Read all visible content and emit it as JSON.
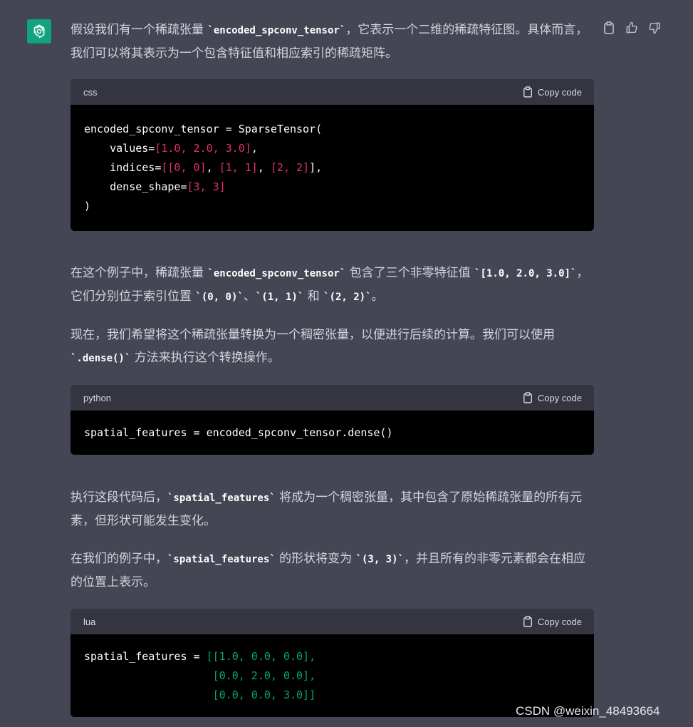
{
  "assistant": {
    "avatar_icon": "openai-logo-icon",
    "avatar_color": "#10a37f"
  },
  "actions": {
    "icons": [
      "clipboard-icon",
      "thumbs-up-icon",
      "thumbs-down-icon"
    ]
  },
  "message": {
    "p1": {
      "t1": "假设我们有一个稀疏张量 ",
      "c1": "`encoded_spconv_tensor`",
      "t2": "，它表示一个二维的稀疏特征图。具体而言，我们可以将其表示为一个包含特征值和相应索引的稀疏矩阵。"
    },
    "code1": {
      "lang": "css",
      "copy_label": "Copy code",
      "l1": "encoded_spconv_tensor = SparseTensor(",
      "l2a": "    values=",
      "l2n": "[1.0, 2.0, 3.0]",
      "l2b": ",",
      "l3a": "    indices=",
      "l3n1": "[[0, 0]",
      "l3s1": ", ",
      "l3n2": "[1, 1]",
      "l3s2": ", ",
      "l3n3": "[2, 2]",
      "l3b": "],",
      "l4a": "    dense_shape=",
      "l4n": "[3, 3]",
      "l5": ")"
    },
    "p2": {
      "t1": "在这个例子中，稀疏张量 ",
      "c1": "`encoded_spconv_tensor`",
      "t2": " 包含了三个非零特征值 ",
      "c2": "`[1.0, 2.0, 3.0]`",
      "t3": "，它们分别位于索引位置 ",
      "c3": "`(0, 0)`",
      "t4": "、",
      "c4": "`(1, 1)`",
      "t5": " 和 ",
      "c5": "`(2, 2)`",
      "t6": "。"
    },
    "p3": {
      "t1": "现在，我们希望将这个稀疏张量转换为一个稠密张量，以便进行后续的计算。我们可以使用 ",
      "c1": "`.dense()`",
      "t2": " 方法来执行这个转换操作。"
    },
    "code2": {
      "lang": "python",
      "copy_label": "Copy code",
      "l1": "spatial_features = encoded_spconv_tensor.dense()"
    },
    "p4": {
      "t1": "执行这段代码后，",
      "c1": "`spatial_features`",
      "t2": " 将成为一个稠密张量，其中包含了原始稀疏张量的所有元素，但形状可能发生变化。"
    },
    "p5": {
      "t1": "在我们的例子中，",
      "c1": "`spatial_features`",
      "t2": " 的形状将变为 ",
      "c2": "`(3, 3)`",
      "t3": "，并且所有的非零元素都会在相应的位置上表示。"
    },
    "code3": {
      "lang": "lua",
      "copy_label": "Copy code",
      "l1a": "spatial_features = ",
      "l1g": "[[1.0, 0.0, 0.0],",
      "l2a": "                    ",
      "l2g": "[0.0, 2.0, 0.0],",
      "l3a": "                    ",
      "l3g": "[0.0, 0.0, 3.0]]"
    }
  },
  "watermark": "CSDN @weixin_48493664"
}
